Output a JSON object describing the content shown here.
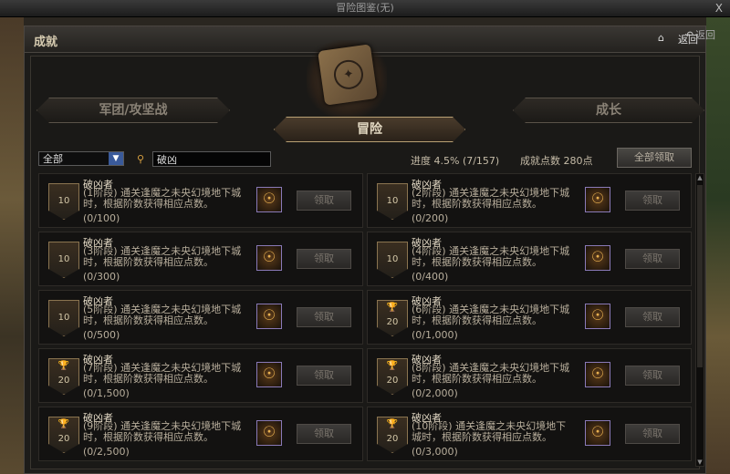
{
  "titlebar": {
    "title": "冒险图鉴(无)",
    "close": "X"
  },
  "window": {
    "title": "成就",
    "back_top": "返回",
    "back_inner": "返回"
  },
  "tabs": {
    "left": "军团/攻坚战",
    "center": "冒险",
    "right": "成长"
  },
  "filter": {
    "selected": "全部"
  },
  "search": {
    "value": "破凶"
  },
  "progress": {
    "label": "进度  4.5% (7/157)"
  },
  "points": {
    "label": "成就点数 280点"
  },
  "claim_all": "全部领取",
  "achievements": [
    {
      "name": "破凶者",
      "desc": "(1阶段) 通关逢魔之未央幻境地下城时，根据阶数获得相应点数。",
      "count": "(0/100)",
      "level": "10",
      "trophy": false,
      "claim": "领取"
    },
    {
      "name": "破凶者",
      "desc": "(2阶段) 通关逢魔之未央幻境地下城时，根据阶数获得相应点数。",
      "count": "(0/200)",
      "level": "10",
      "trophy": false,
      "claim": "领取"
    },
    {
      "name": "破凶者",
      "desc": "(3阶段) 通关逢魔之未央幻境地下城时，根据阶数获得相应点数。",
      "count": "(0/300)",
      "level": "10",
      "trophy": false,
      "claim": "领取"
    },
    {
      "name": "破凶者",
      "desc": "(4阶段) 通关逢魔之未央幻境地下城时，根据阶数获得相应点数。",
      "count": "(0/400)",
      "level": "10",
      "trophy": false,
      "claim": "领取"
    },
    {
      "name": "破凶者",
      "desc": "(5阶段) 通关逢魔之未央幻境地下城时，根据阶数获得相应点数。",
      "count": "(0/500)",
      "level": "10",
      "trophy": false,
      "claim": "领取"
    },
    {
      "name": "破凶者",
      "desc": "(6阶段) 通关逢魔之未央幻境地下城时，根据阶数获得相应点数。",
      "count": "(0/1,000)",
      "level": "20",
      "trophy": true,
      "claim": "领取"
    },
    {
      "name": "破凶者",
      "desc": "(7阶段) 通关逢魔之未央幻境地下城时，根据阶数获得相应点数。",
      "count": "(0/1,500)",
      "level": "20",
      "trophy": true,
      "claim": "领取"
    },
    {
      "name": "破凶者",
      "desc": "(8阶段) 通关逢魔之未央幻境地下城时，根据阶数获得相应点数。",
      "count": "(0/2,000)",
      "level": "20",
      "trophy": true,
      "claim": "领取"
    },
    {
      "name": "破凶者",
      "desc": "(9阶段) 通关逢魔之未央幻境地下城时，根据阶数获得相应点数。",
      "count": "(0/2,500)",
      "level": "20",
      "trophy": true,
      "claim": "领取"
    },
    {
      "name": "破凶者",
      "desc": "(10阶段) 通关逢魔之未央幻境地下城时，根据阶数获得相应点数。",
      "count": "(0/3,000)",
      "level": "20",
      "trophy": true,
      "claim": "领取"
    }
  ]
}
